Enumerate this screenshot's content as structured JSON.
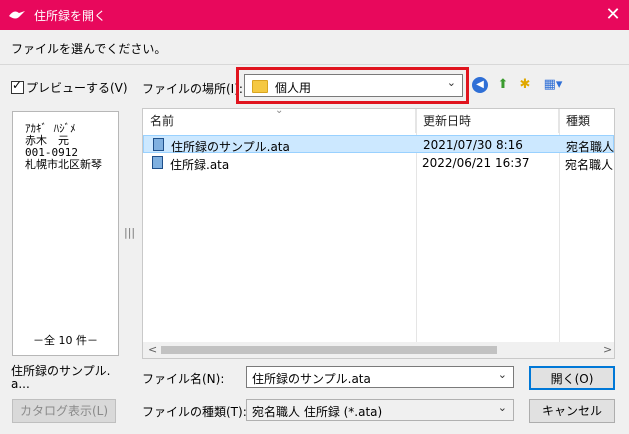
{
  "window": {
    "title": "住所録を開く",
    "close_glyph": "✕"
  },
  "instruction": "ファイルを選んでください。",
  "preview": {
    "checkbox_label": "プレビューする(V)",
    "checked": true,
    "lines": [
      "ｱｶｷﾞ ﾊｼﾞﾒ",
      "赤木　元",
      "001-0912",
      "札幌市北区新琴"
    ],
    "count": "－全 10 件－",
    "filename_line1": "住所録のサンプル.",
    "filename_line2": "a...",
    "catalog_button": "カタログ表示(L)"
  },
  "location": {
    "label": "ファイルの場所(I):",
    "value": "個人用"
  },
  "toolbar": {
    "icons": [
      "back-icon",
      "up-folder-icon",
      "new-folder-icon",
      "view-menu-icon"
    ],
    "glyphs": [
      "➔",
      "⬆",
      "✱",
      "▦▾"
    ]
  },
  "list": {
    "columns": [
      "名前",
      "更新日時",
      "種類"
    ],
    "rows": [
      {
        "name": "住所録のサンプル.ata",
        "date": "2021/07/30 8:16",
        "type": "宛名職人",
        "selected": true
      },
      {
        "name": "住所録.ata",
        "date": "2022/06/21 16:37",
        "type": "宛名職人",
        "selected": false
      }
    ],
    "sort_glyph": "⌄"
  },
  "filename": {
    "label": "ファイル名(N):",
    "value": "住所録のサンプル.ata"
  },
  "filetype": {
    "label": "ファイルの種類(T):",
    "value": "宛名職人 住所録 (*.ata)"
  },
  "buttons": {
    "open": "開く(O)",
    "cancel": "キャンセル"
  },
  "colors": {
    "titlebar": "#e8085c",
    "highlight": "#e0141e",
    "selection": "#cce8ff"
  }
}
